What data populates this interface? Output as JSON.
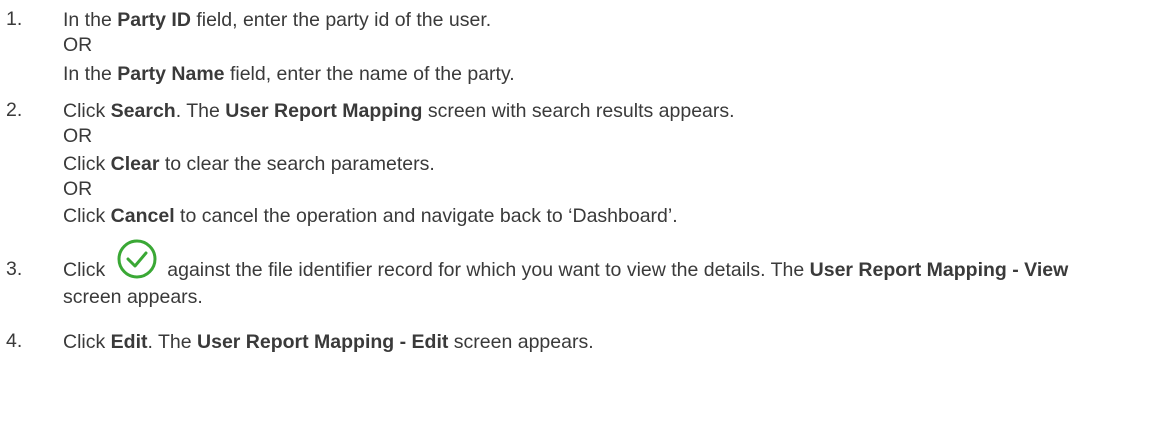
{
  "step1": {
    "num": "1.",
    "l1_pre": "In the ",
    "l1_bold": "Party ID",
    "l1_post": " field, enter the party id of the user.",
    "or": "OR",
    "l3_pre": "In the ",
    "l3_bold": "Party Name",
    "l3_post": " field, enter the name of the party."
  },
  "step2": {
    "num": "2.",
    "l1_pre": "Click ",
    "l1_b1": "Search",
    "l1_mid": ". The ",
    "l1_b2": "User Report Mapping",
    "l1_post": " screen with search results appears.",
    "or1": "OR",
    "l3_pre": "Click ",
    "l3_bold": "Clear",
    "l3_post": " to clear the search parameters.",
    "or2": "OR",
    "l5_pre": "Click ",
    "l5_bold": "Cancel",
    "l5_post": " to cancel the operation and navigate back to ‘Dashboard’."
  },
  "step3": {
    "num": "3.",
    "pre": "Click",
    "icon": "check-circle-icon",
    "icon_color": "#3aa835",
    "mid": "against the file identifier record for which you want to view the details. The ",
    "b1": "User Report Mapping - View",
    "post": " screen appears."
  },
  "step4": {
    "num": "4.",
    "pre": "Click ",
    "b1": "Edit",
    "mid": ". The ",
    "b2": "User Report Mapping - Edit",
    "post": " screen appears."
  }
}
